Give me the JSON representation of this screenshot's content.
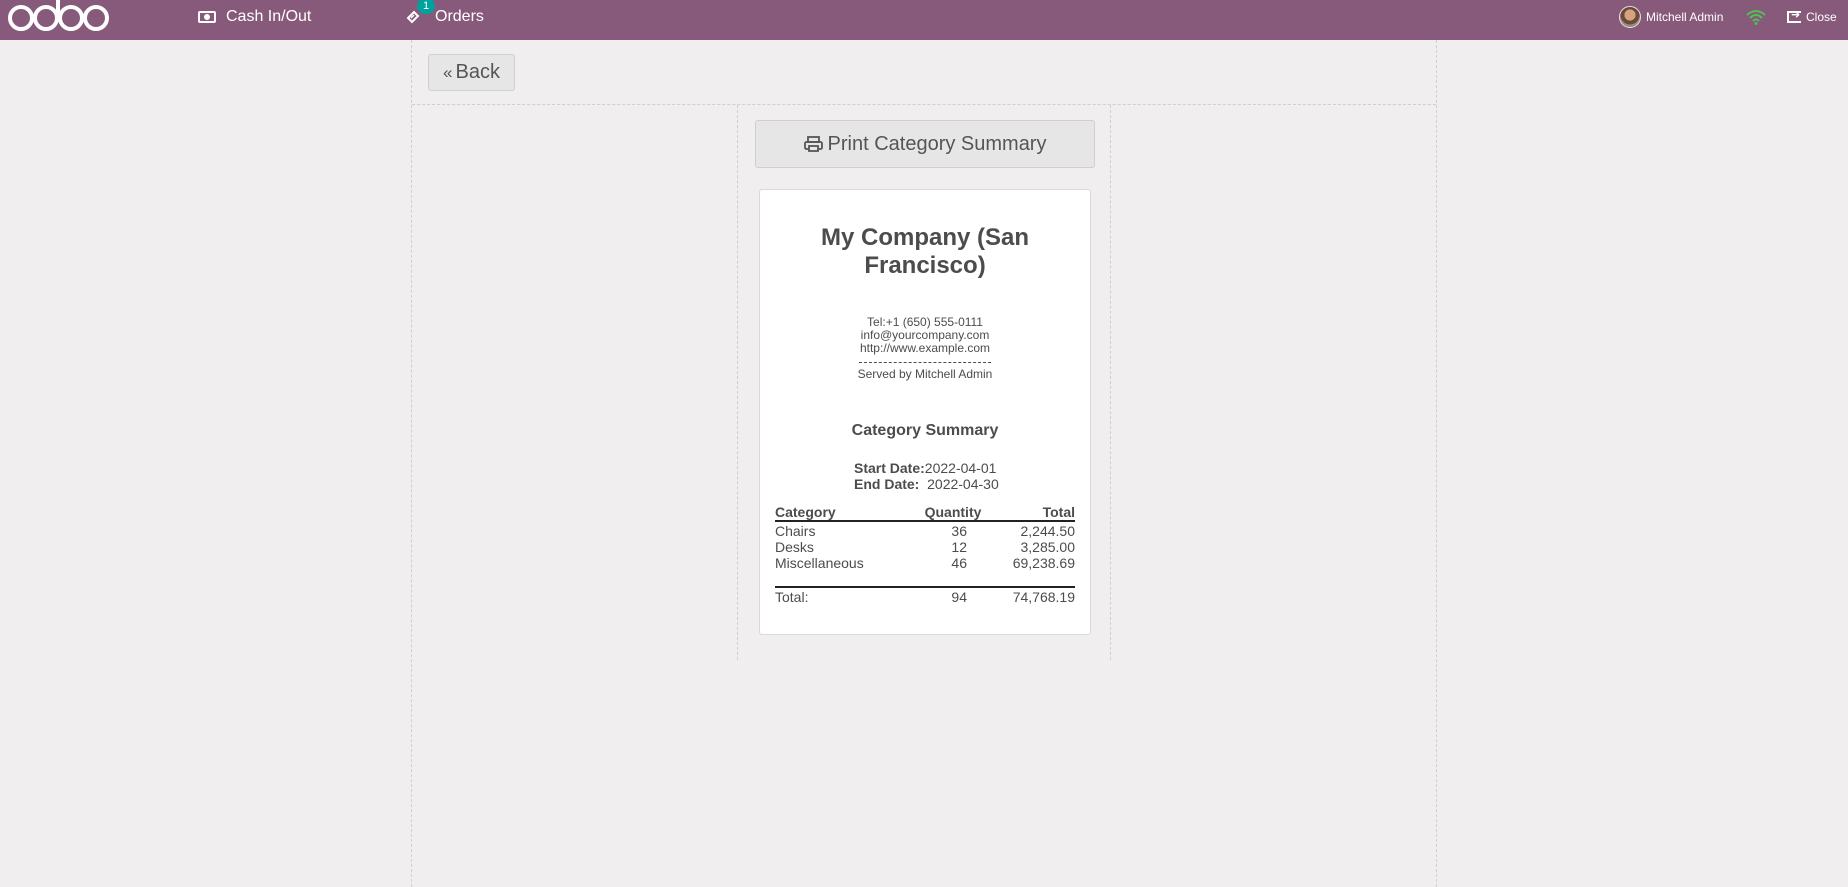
{
  "navbar": {
    "cash_label": "Cash In/Out",
    "orders_label": "Orders",
    "orders_badge": "1",
    "user_name": "Mitchell Admin",
    "close_label": "Close",
    "accent_color": "#875a7b"
  },
  "back_label": "Back",
  "print_label": "Print Category Summary",
  "receipt": {
    "company_name": "My Company (San Francisco)",
    "tel": "Tel:+1 (650) 555-0111",
    "email": "info@yourcompany.com",
    "website": "http://www.example.com",
    "served_by": "Served by Mitchell Admin",
    "title": "Category Summary",
    "start_date_label": "Start Date:",
    "start_date": "2022-04-01",
    "end_date_label": "End Date:",
    "end_date": "2022-04-30",
    "columns": [
      "Category",
      "Quantity",
      "Total"
    ],
    "rows": [
      {
        "category": "Chairs",
        "quantity": "36",
        "total": "2,244.50"
      },
      {
        "category": "Desks",
        "quantity": "12",
        "total": "3,285.00"
      },
      {
        "category": "Miscellaneous",
        "quantity": "46",
        "total": "69,238.69"
      }
    ],
    "total_label": "Total:",
    "total_quantity": "94",
    "total_amount": "74,768.19"
  }
}
